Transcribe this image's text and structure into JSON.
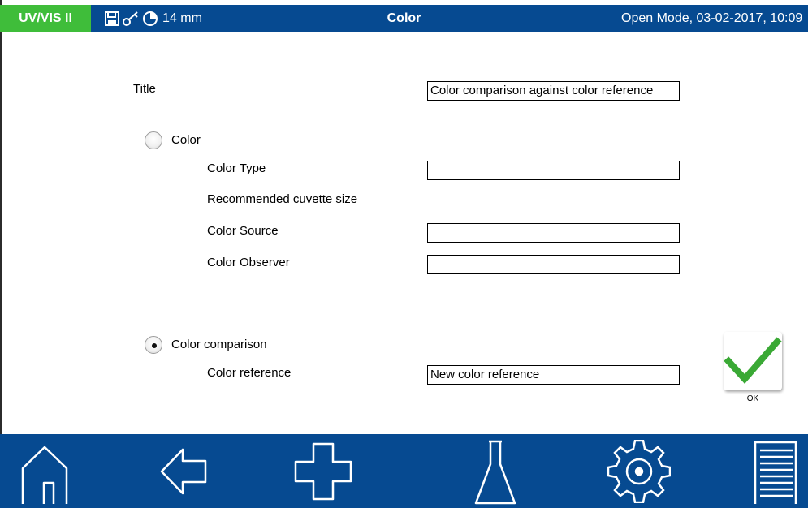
{
  "header": {
    "app_badge": "UV/VIS II",
    "cuvette_size": "14 mm",
    "title": "Color",
    "status": "Open Mode, 03-02-2017, 10:09",
    "icons": [
      "save-icon",
      "key-icon",
      "pie-timer-icon"
    ]
  },
  "form": {
    "title_label": "Title",
    "title_value": "Color comparison against color reference",
    "color_option_label": "Color",
    "color_option_selected": false,
    "color_type_label": "Color Type",
    "color_type_value": "",
    "recommended_cuvette_label": "Recommended cuvette size",
    "color_source_label": "Color Source",
    "color_source_value": "",
    "color_observer_label": "Color Observer",
    "color_observer_value": "",
    "comparison_option_label": "Color comparison",
    "comparison_option_selected": true,
    "color_reference_label": "Color reference",
    "color_reference_value": "New color reference"
  },
  "ok": {
    "label": "OK",
    "icon": "checkmark-icon"
  },
  "nav": {
    "icons": [
      "home-icon",
      "back-arrow-icon",
      "plus-icon",
      "flask-icon",
      "gear-icon",
      "menu-list-icon"
    ]
  },
  "colors": {
    "header_bg": "#064a91",
    "badge_bg": "#3fbd3a",
    "check": "#3aa935"
  }
}
